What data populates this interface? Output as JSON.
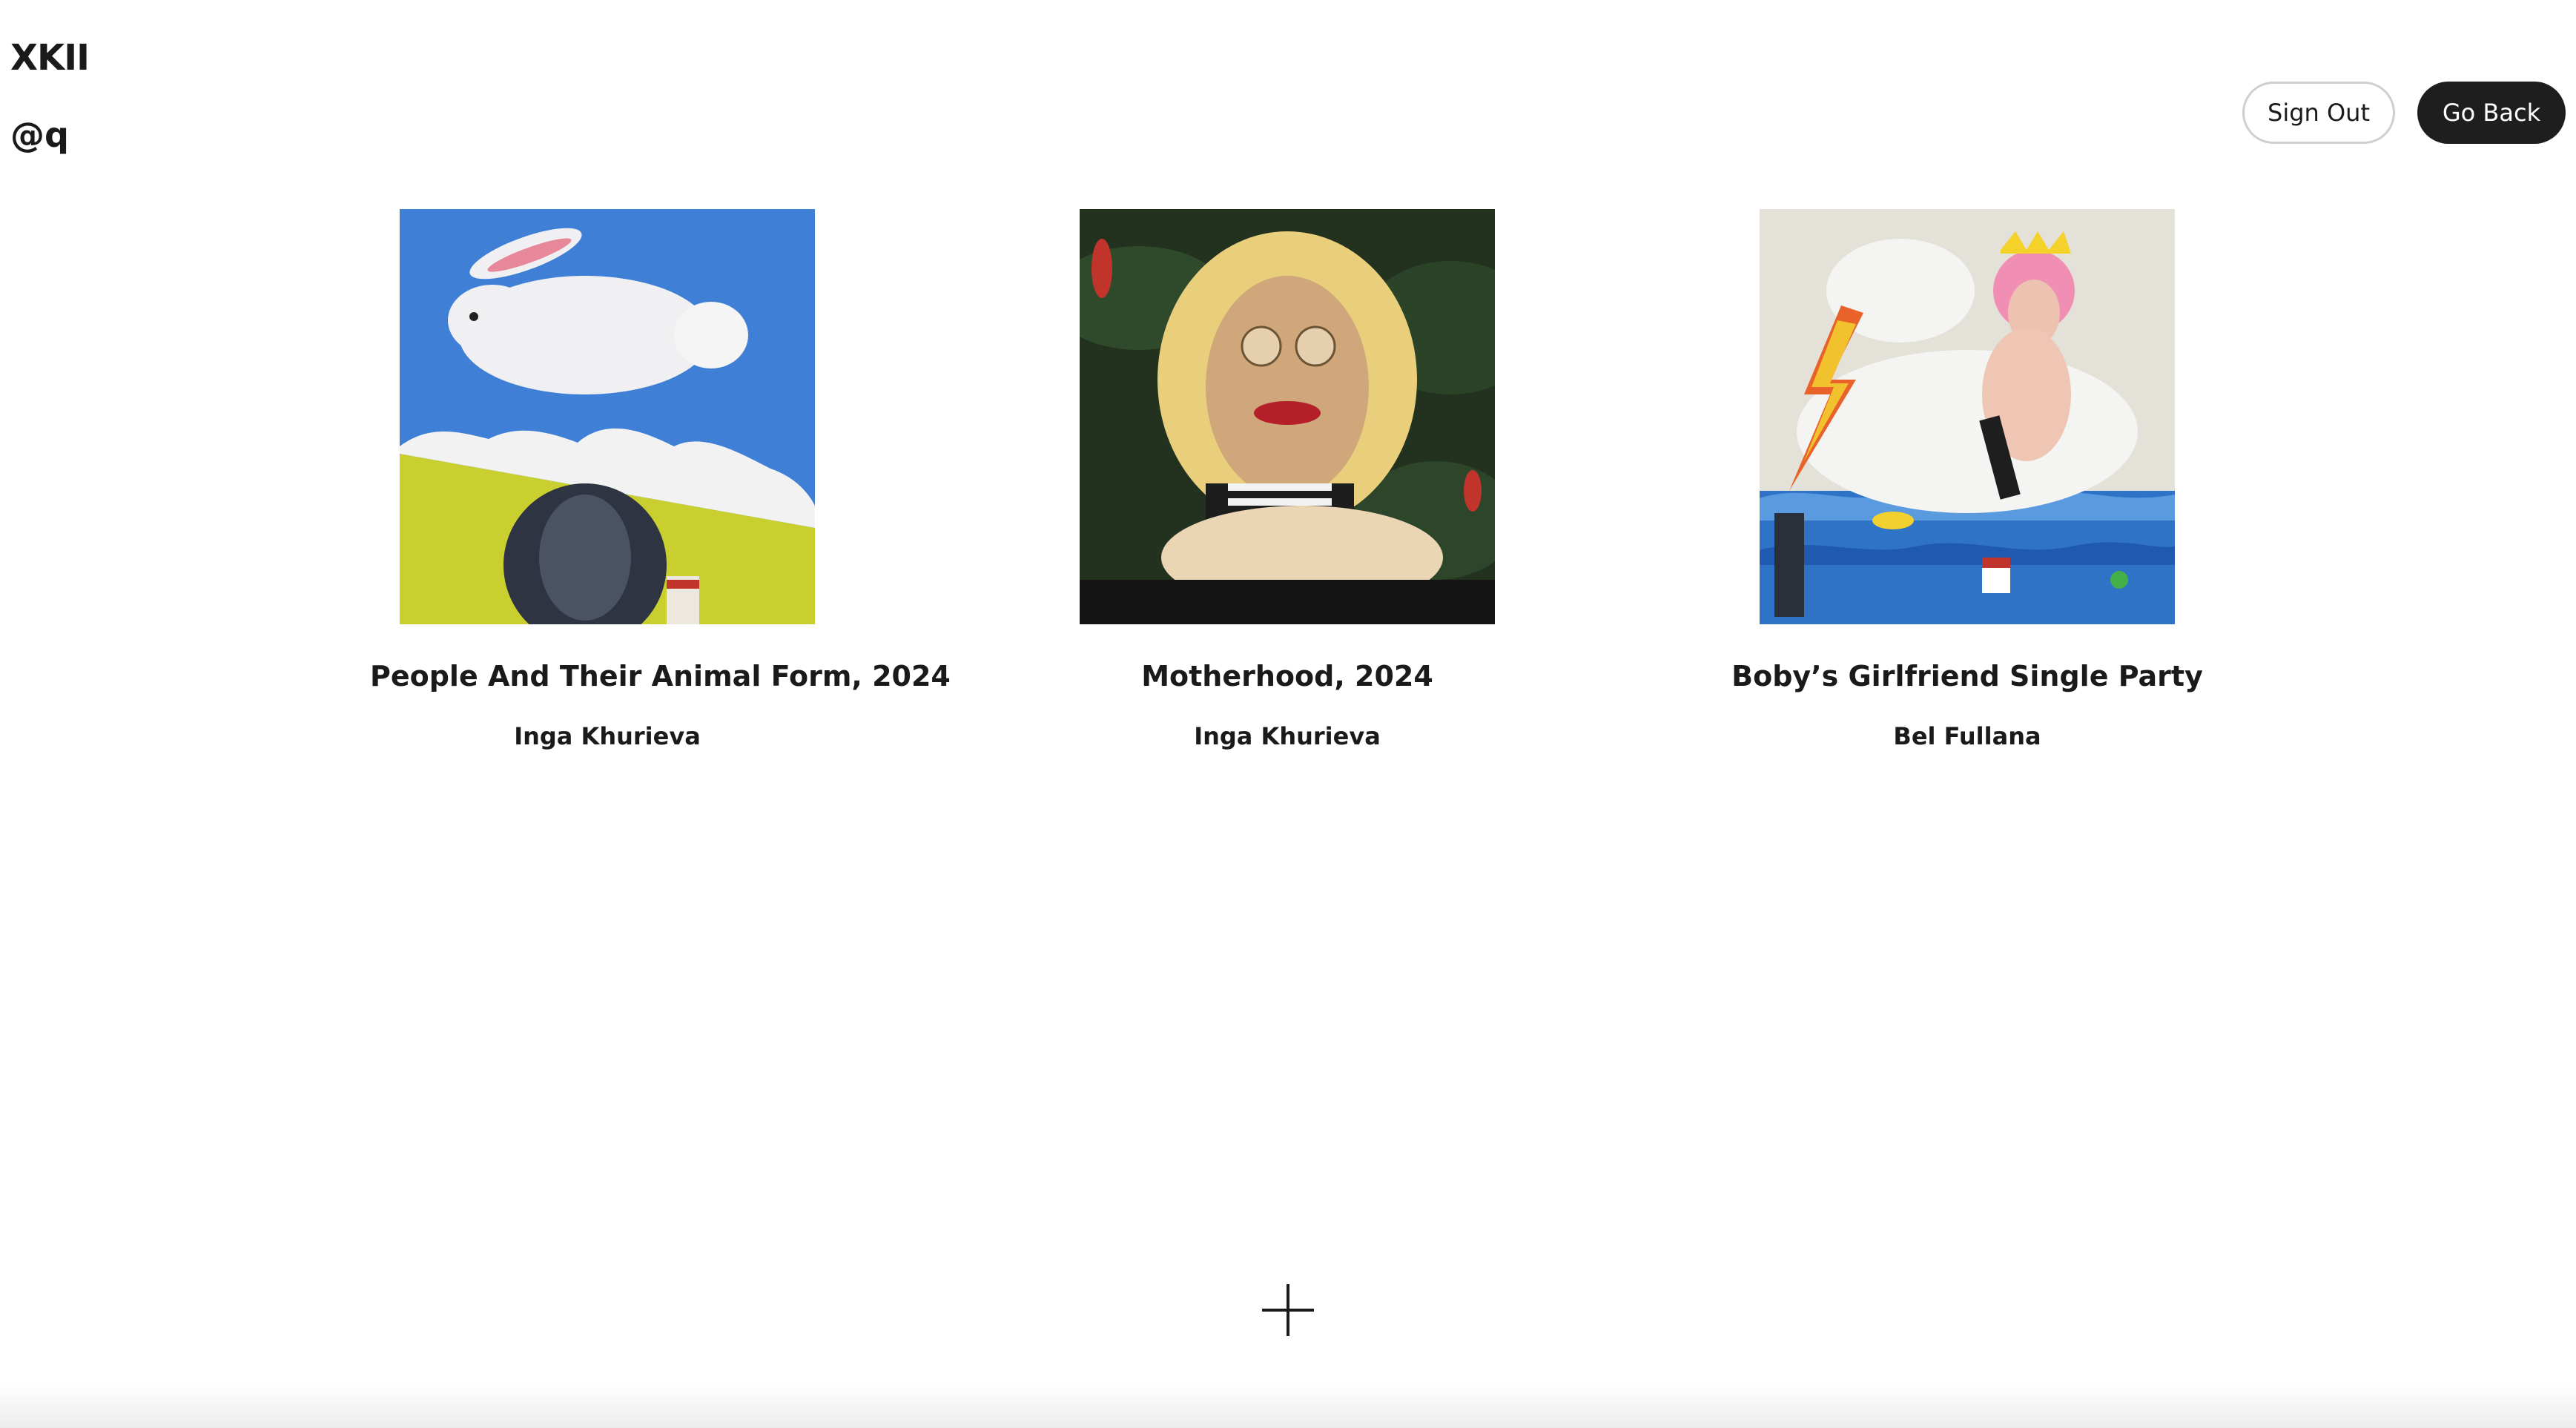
{
  "header": {
    "brand": "XKII",
    "user_handle": "@q"
  },
  "actions": {
    "sign_out_label": "Sign Out",
    "go_back_label": "Go Back"
  },
  "artworks": [
    {
      "title": "People And Their Animal Form, 2024",
      "artist": "Inga Khurieva"
    },
    {
      "title": "Motherhood, 2024",
      "artist": "Inga Khurieva"
    },
    {
      "title": "Boby’s Girlfriend Single Party",
      "artist": "Bel Fullana"
    }
  ],
  "add_button": {
    "icon": "plus-icon"
  }
}
